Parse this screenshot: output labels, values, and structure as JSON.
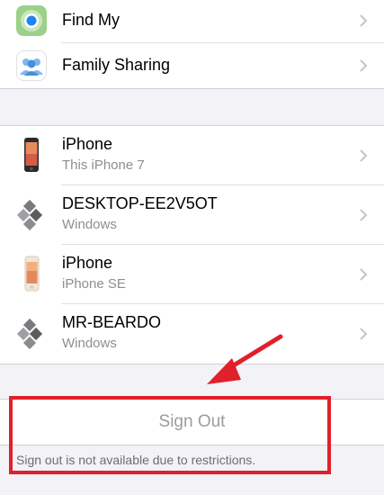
{
  "apps": [
    {
      "label": "Find My",
      "icon": "find-my-icon"
    },
    {
      "label": "Family Sharing",
      "icon": "family-sharing-icon"
    }
  ],
  "devices": [
    {
      "name": "iPhone",
      "detail": "This iPhone 7",
      "icon": "iphone-dark-icon"
    },
    {
      "name": "DESKTOP-EE2V5OT",
      "detail": "Windows",
      "icon": "windows-pc-icon"
    },
    {
      "name": "iPhone",
      "detail": "iPhone SE",
      "icon": "iphone-light-icon"
    },
    {
      "name": "MR-BEARDO",
      "detail": "Windows",
      "icon": "windows-pc-icon"
    }
  ],
  "sign_out": {
    "label": "Sign Out",
    "note": "Sign out is not available due to restrictions."
  },
  "annotation": {
    "color": "#e0202a"
  }
}
